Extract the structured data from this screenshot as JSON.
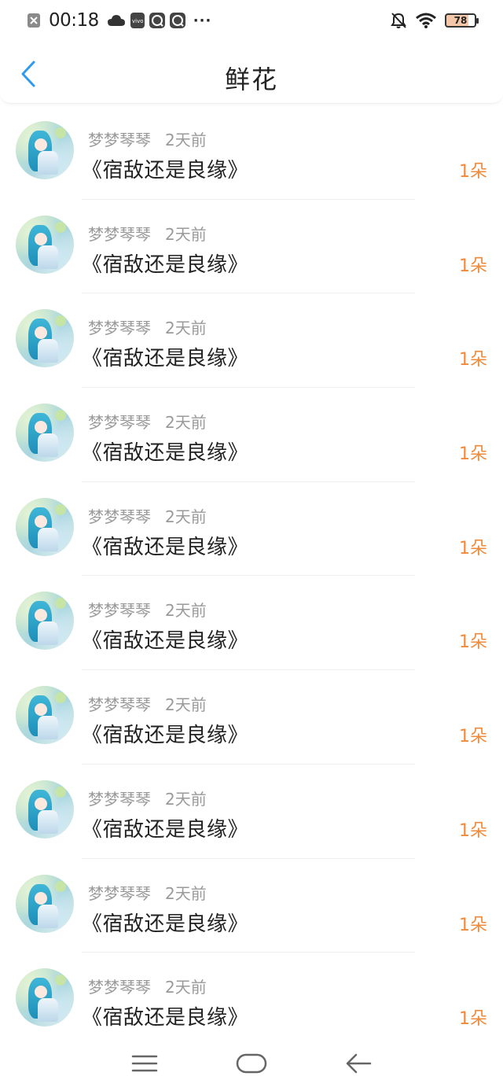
{
  "status_bar": {
    "time": "00:18",
    "battery": "78",
    "icons": [
      "close-box-icon",
      "cloud-icon",
      "vivo-icon",
      "du-icon",
      "du-icon",
      "more-dots-icon",
      "mute-bell-icon",
      "wifi-icon",
      "battery-icon"
    ]
  },
  "header": {
    "title": "鲜花",
    "back_icon": "chevron-left-icon"
  },
  "list": [
    {
      "user": "梦梦琴琴",
      "time": "2天前",
      "book": "《宿敌还是良缘》",
      "amount": "1朵"
    },
    {
      "user": "梦梦琴琴",
      "time": "2天前",
      "book": "《宿敌还是良缘》",
      "amount": "1朵"
    },
    {
      "user": "梦梦琴琴",
      "time": "2天前",
      "book": "《宿敌还是良缘》",
      "amount": "1朵"
    },
    {
      "user": "梦梦琴琴",
      "time": "2天前",
      "book": "《宿敌还是良缘》",
      "amount": "1朵"
    },
    {
      "user": "梦梦琴琴",
      "time": "2天前",
      "book": "《宿敌还是良缘》",
      "amount": "1朵"
    },
    {
      "user": "梦梦琴琴",
      "time": "2天前",
      "book": "《宿敌还是良缘》",
      "amount": "1朵"
    },
    {
      "user": "梦梦琴琴",
      "time": "2天前",
      "book": "《宿敌还是良缘》",
      "amount": "1朵"
    },
    {
      "user": "梦梦琴琴",
      "time": "2天前",
      "book": "《宿敌还是良缘》",
      "amount": "1朵"
    },
    {
      "user": "梦梦琴琴",
      "time": "2天前",
      "book": "《宿敌还是良缘》",
      "amount": "1朵"
    },
    {
      "user": "梦梦琴琴",
      "time": "2天前",
      "book": "《宿敌还是良缘》",
      "amount": "1朵"
    }
  ],
  "bottom_nav": {
    "items": [
      "menu-icon",
      "home-icon",
      "back-arrow-icon"
    ]
  },
  "colors": {
    "accent": "#2e9bf0",
    "amount": "#f08a3a",
    "meta": "#9a9a9a",
    "title": "#222222"
  }
}
